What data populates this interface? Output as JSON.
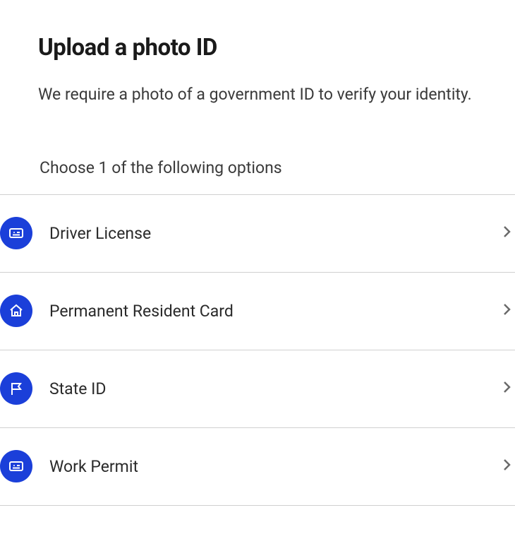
{
  "header": {
    "title": "Upload a photo ID",
    "description": "We require a photo of a government ID to verify your identity."
  },
  "section": {
    "label": "Choose 1 of the following options"
  },
  "options": [
    {
      "label": "Driver License",
      "icon": "id-card-icon"
    },
    {
      "label": "Permanent Resident Card",
      "icon": "home-icon"
    },
    {
      "label": "State ID",
      "icon": "flag-icon"
    },
    {
      "label": "Work Permit",
      "icon": "id-card-icon"
    }
  ],
  "colors": {
    "accent": "#1b3fd9"
  }
}
